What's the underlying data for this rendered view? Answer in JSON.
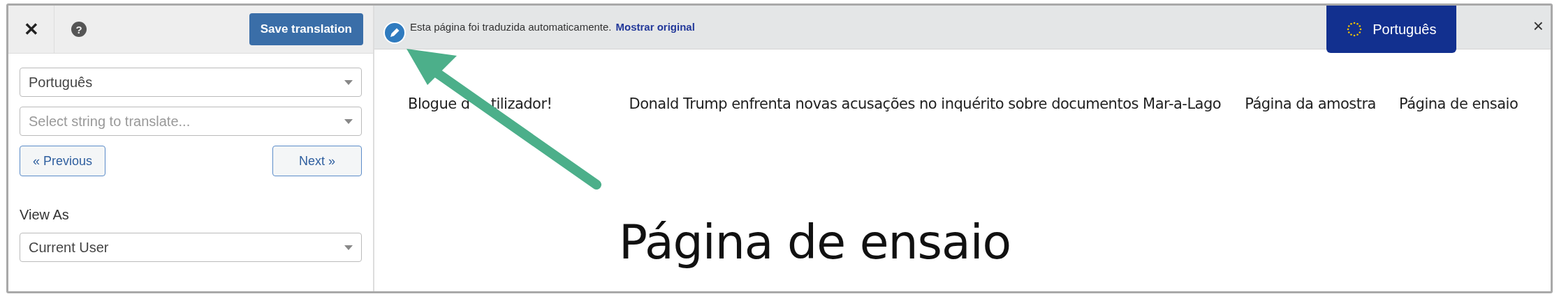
{
  "sidebar": {
    "close_label": "✕",
    "help_label": "?",
    "save_button": "Save translation",
    "language_select": {
      "value": "Português"
    },
    "string_select": {
      "placeholder": "Select string to translate..."
    },
    "previous_button": "« Previous",
    "next_button": "Next »",
    "view_as_label": "View As",
    "view_as_select": {
      "value": "Current User"
    }
  },
  "translation_bar": {
    "message": "Esta página foi traduzida automaticamente.",
    "link": "Mostrar original",
    "language_button": "Português",
    "close_label": "×"
  },
  "nav": [
    {
      "visible_parts": [
        "Blogue d",
        "tilizador!"
      ]
    },
    {
      "label": "Donald Trump enfrenta novas acusações no inquérito sobre documentos Mar-a-Lago"
    },
    {
      "label": "Página da amostra"
    },
    {
      "label": "Página de ensaio"
    }
  ],
  "page_title": "Página de ensaio"
}
